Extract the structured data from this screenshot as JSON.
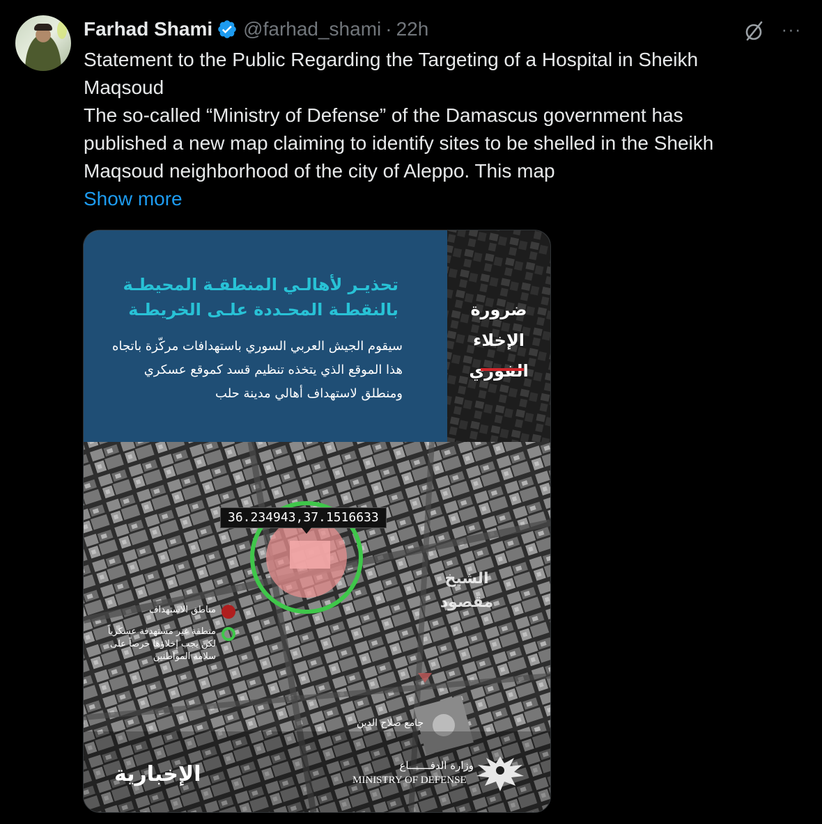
{
  "author": {
    "name": "Farhad Shami",
    "handle": "@farhad_shami",
    "separator": "·",
    "time": "22h",
    "verified": true,
    "verified_color": "#1d9bf0"
  },
  "actions": {
    "grok_icon": "slashed-circle-icon",
    "more_label": "···"
  },
  "tweet": {
    "lines": [
      "Statement to the Public Regarding the Targeting of a Hospital in Sheikh",
      "Maqsoud",
      "The so-called “Ministry of Defense” of the Damascus government has",
      "published a new map claiming to identify sites to be shelled in the Sheikh",
      "Maqsoud neighborhood of the city of Aleppo. This map"
    ],
    "show_more": "Show more",
    "link_color": "#1d9bf0"
  },
  "media": {
    "banner_title": "تحذيـر لأهالـي المنطقـة المحيطـة بالنقطـة المحـددة علـى الخريطـة",
    "banner_body": "سيقوم الجيش العربي السوري باستهدافات مركّزة باتجاه هذا الموقع الذي يتخذه تنظيم قسد كموقع عسكري ومنطلق لاستهداف أهالي مدينة حلب",
    "side_title": "ضرورة الإخلاء الفوري",
    "coordinates": "36.234943,37.1516633",
    "district": "الشيخ مقصود",
    "legend_target": "مناطق الاستهداف",
    "legend_non_target": "منطقة غير مستهدفة عسكرياً لكن يجب إخلاؤها حرصاً على سلامة المواطنين",
    "mosque": "جامع صلاح الدين",
    "brand_left": "الإخبارية",
    "ministry_ar": "وزارة الدفـــــــاع",
    "ministry_en": "MINISTRY OF DEFENSE",
    "banner_color": "#1f4e75",
    "title_color": "#28c2d6",
    "target_ring_color": "#3fc74a",
    "target_fill_color": "#e88f8f",
    "legend_red": "#b01e1e"
  }
}
